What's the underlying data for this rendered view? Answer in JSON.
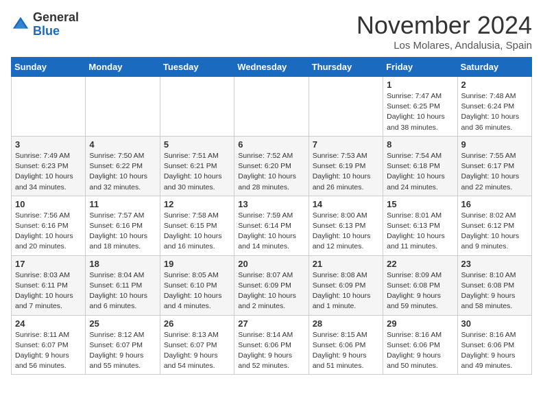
{
  "logo": {
    "general": "General",
    "blue": "Blue"
  },
  "header": {
    "month": "November 2024",
    "location": "Los Molares, Andalusia, Spain"
  },
  "days_of_week": [
    "Sunday",
    "Monday",
    "Tuesday",
    "Wednesday",
    "Thursday",
    "Friday",
    "Saturday"
  ],
  "weeks": [
    [
      {
        "day": "",
        "info": ""
      },
      {
        "day": "",
        "info": ""
      },
      {
        "day": "",
        "info": ""
      },
      {
        "day": "",
        "info": ""
      },
      {
        "day": "",
        "info": ""
      },
      {
        "day": "1",
        "info": "Sunrise: 7:47 AM\nSunset: 6:25 PM\nDaylight: 10 hours\nand 38 minutes."
      },
      {
        "day": "2",
        "info": "Sunrise: 7:48 AM\nSunset: 6:24 PM\nDaylight: 10 hours\nand 36 minutes."
      }
    ],
    [
      {
        "day": "3",
        "info": "Sunrise: 7:49 AM\nSunset: 6:23 PM\nDaylight: 10 hours\nand 34 minutes."
      },
      {
        "day": "4",
        "info": "Sunrise: 7:50 AM\nSunset: 6:22 PM\nDaylight: 10 hours\nand 32 minutes."
      },
      {
        "day": "5",
        "info": "Sunrise: 7:51 AM\nSunset: 6:21 PM\nDaylight: 10 hours\nand 30 minutes."
      },
      {
        "day": "6",
        "info": "Sunrise: 7:52 AM\nSunset: 6:20 PM\nDaylight: 10 hours\nand 28 minutes."
      },
      {
        "day": "7",
        "info": "Sunrise: 7:53 AM\nSunset: 6:19 PM\nDaylight: 10 hours\nand 26 minutes."
      },
      {
        "day": "8",
        "info": "Sunrise: 7:54 AM\nSunset: 6:18 PM\nDaylight: 10 hours\nand 24 minutes."
      },
      {
        "day": "9",
        "info": "Sunrise: 7:55 AM\nSunset: 6:17 PM\nDaylight: 10 hours\nand 22 minutes."
      }
    ],
    [
      {
        "day": "10",
        "info": "Sunrise: 7:56 AM\nSunset: 6:16 PM\nDaylight: 10 hours\nand 20 minutes."
      },
      {
        "day": "11",
        "info": "Sunrise: 7:57 AM\nSunset: 6:16 PM\nDaylight: 10 hours\nand 18 minutes."
      },
      {
        "day": "12",
        "info": "Sunrise: 7:58 AM\nSunset: 6:15 PM\nDaylight: 10 hours\nand 16 minutes."
      },
      {
        "day": "13",
        "info": "Sunrise: 7:59 AM\nSunset: 6:14 PM\nDaylight: 10 hours\nand 14 minutes."
      },
      {
        "day": "14",
        "info": "Sunrise: 8:00 AM\nSunset: 6:13 PM\nDaylight: 10 hours\nand 12 minutes."
      },
      {
        "day": "15",
        "info": "Sunrise: 8:01 AM\nSunset: 6:13 PM\nDaylight: 10 hours\nand 11 minutes."
      },
      {
        "day": "16",
        "info": "Sunrise: 8:02 AM\nSunset: 6:12 PM\nDaylight: 10 hours\nand 9 minutes."
      }
    ],
    [
      {
        "day": "17",
        "info": "Sunrise: 8:03 AM\nSunset: 6:11 PM\nDaylight: 10 hours\nand 7 minutes."
      },
      {
        "day": "18",
        "info": "Sunrise: 8:04 AM\nSunset: 6:11 PM\nDaylight: 10 hours\nand 6 minutes."
      },
      {
        "day": "19",
        "info": "Sunrise: 8:05 AM\nSunset: 6:10 PM\nDaylight: 10 hours\nand 4 minutes."
      },
      {
        "day": "20",
        "info": "Sunrise: 8:07 AM\nSunset: 6:09 PM\nDaylight: 10 hours\nand 2 minutes."
      },
      {
        "day": "21",
        "info": "Sunrise: 8:08 AM\nSunset: 6:09 PM\nDaylight: 10 hours\nand 1 minute."
      },
      {
        "day": "22",
        "info": "Sunrise: 8:09 AM\nSunset: 6:08 PM\nDaylight: 9 hours\nand 59 minutes."
      },
      {
        "day": "23",
        "info": "Sunrise: 8:10 AM\nSunset: 6:08 PM\nDaylight: 9 hours\nand 58 minutes."
      }
    ],
    [
      {
        "day": "24",
        "info": "Sunrise: 8:11 AM\nSunset: 6:07 PM\nDaylight: 9 hours\nand 56 minutes."
      },
      {
        "day": "25",
        "info": "Sunrise: 8:12 AM\nSunset: 6:07 PM\nDaylight: 9 hours\nand 55 minutes."
      },
      {
        "day": "26",
        "info": "Sunrise: 8:13 AM\nSunset: 6:07 PM\nDaylight: 9 hours\nand 54 minutes."
      },
      {
        "day": "27",
        "info": "Sunrise: 8:14 AM\nSunset: 6:06 PM\nDaylight: 9 hours\nand 52 minutes."
      },
      {
        "day": "28",
        "info": "Sunrise: 8:15 AM\nSunset: 6:06 PM\nDaylight: 9 hours\nand 51 minutes."
      },
      {
        "day": "29",
        "info": "Sunrise: 8:16 AM\nSunset: 6:06 PM\nDaylight: 9 hours\nand 50 minutes."
      },
      {
        "day": "30",
        "info": "Sunrise: 8:16 AM\nSunset: 6:06 PM\nDaylight: 9 hours\nand 49 minutes."
      }
    ]
  ]
}
